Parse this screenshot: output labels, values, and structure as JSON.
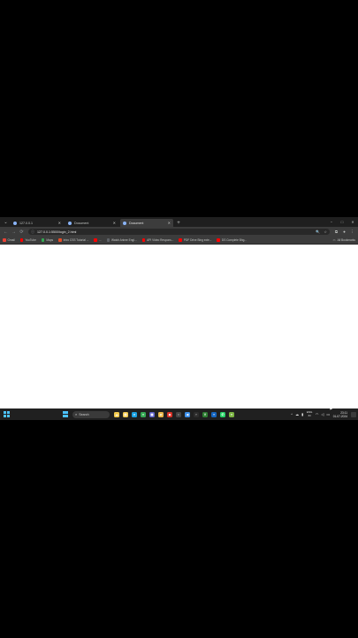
{
  "browser": {
    "tabs": [
      {
        "title": "127.0.0.1",
        "active": false,
        "favicon_color": "#8ab4f8"
      },
      {
        "title": "Document",
        "active": false,
        "favicon_color": "#8ab4f8"
      },
      {
        "title": "Document",
        "active": true,
        "favicon_color": "#8ab4f8"
      }
    ],
    "new_tab_label": "+",
    "window_controls": {
      "minimize": "−",
      "maximize": "□",
      "close": "✕"
    },
    "toolbar": {
      "back": "←",
      "forward": "→",
      "reload": "⟳",
      "url": "127.0.0.1:5500/login_2.html",
      "info_icon": "ⓘ",
      "zoom_icon": "🔍",
      "star_icon": "☆",
      "extensions_icon": "⧉",
      "profile_icon": "●",
      "menu_icon": "⋮"
    },
    "bookmarks": [
      {
        "label": "Gmail",
        "color": "#ea4335"
      },
      {
        "label": "YouTube",
        "color": "#ff0000"
      },
      {
        "label": "Maps",
        "color": "#34a853"
      },
      {
        "label": "Intro CSS Tutorial ...",
        "color": "#e44d26"
      },
      {
        "label": "...",
        "color": "#ff0000"
      },
      {
        "label": "Watch Anime Engl...",
        "color": "#5f6368"
      },
      {
        "label": "API Video Respons...",
        "color": "#ff0000"
      },
      {
        "label": "PDF Drive Bing exte...",
        "color": "#ff0000"
      },
      {
        "label": "DS Complete Bhg...",
        "color": "#ff0000"
      }
    ],
    "all_bookmarks": "All Bookmarks"
  },
  "taskbar": {
    "search_label": "Search",
    "apps": [
      {
        "name": "weather",
        "glyph": "☁",
        "color": "#f2c94c"
      },
      {
        "name": "file-explorer",
        "glyph": "▤",
        "color": "#f2c94c"
      },
      {
        "name": "edge",
        "glyph": "e",
        "color": "#1ba1e2"
      },
      {
        "name": "chrome",
        "glyph": "●",
        "color": "#34a853"
      },
      {
        "name": "store",
        "glyph": "▦",
        "color": "#5b5fc7"
      },
      {
        "name": "folder",
        "glyph": "▰",
        "color": "#e8b84a"
      },
      {
        "name": "app-red",
        "glyph": "◆",
        "color": "#d93025"
      },
      {
        "name": "app-dark",
        "glyph": "▪",
        "color": "#444444"
      },
      {
        "name": "vscode",
        "glyph": "◀",
        "color": "#3b8eea"
      },
      {
        "name": "terminal",
        "glyph": "›",
        "color": "#2d2d2d"
      },
      {
        "name": "app-green",
        "glyph": "V",
        "color": "#2e7d32"
      },
      {
        "name": "app-blue",
        "glyph": "≡",
        "color": "#1565c0"
      },
      {
        "name": "whatsapp",
        "glyph": "✆",
        "color": "#25d366"
      },
      {
        "name": "app-chrome2",
        "glyph": "●",
        "color": "#7cb342"
      }
    ],
    "tray": {
      "language_line1": "ENG",
      "language_line2": "IN",
      "time": "23:11",
      "date": "01-07-2024"
    }
  }
}
